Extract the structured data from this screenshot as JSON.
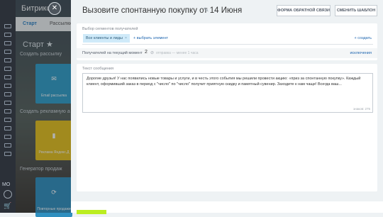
{
  "app": {
    "brand": "Битрикс"
  },
  "background": {
    "tabs": [
      {
        "label": "Старт"
      },
      {
        "label": "Рассылки"
      }
    ],
    "start_heading": "Старт ★",
    "sections": [
      {
        "label": "Создать рассылку"
      },
      {
        "label": "Создать рекламную а"
      },
      {
        "label": "Генератор продаж"
      }
    ],
    "cards": [
      {
        "label": "Email рассылка",
        "color": "#2f9fc9"
      },
      {
        "label": "Реклама Яндекс.Д",
        "color": "#e8c21a"
      },
      {
        "label": "Повторные продажи",
        "color": "#2f8fbf"
      }
    ]
  },
  "left_rail": {
    "badge": "МО"
  },
  "header": {
    "title": "Вызовите спонтанную покупку от 14 Июня",
    "feedback_label": "Форма обратной связи",
    "change_template_label": "Сменить шаблон"
  },
  "segments": {
    "label": "Выбор сегментов получателей",
    "selected_chip": "Все клиенты и лиды",
    "choose_link": "+ выбрать элемент",
    "create_link": "+ создать",
    "recipients_label": "Получателей на текущий момент",
    "recipients_count": "2",
    "recipients_note": "отправка — менее 1 часа",
    "exclusions_link": "исключения"
  },
  "message": {
    "label": "Текст сообщения",
    "text": "Дорогие друзья! У нас появились новые товары и услуги, и в честь этого события мы решили провести акцию: «приз за спонтанную покупку». Каждый клиент, оформивший заказ в период с \"число\" по \"число\" получит приятную скидку и памятный сувенир. Заходите к нам чаще! Всегда ваш...",
    "char_count": "знаков: 275"
  },
  "colors": {
    "accent_green": "#bbed21",
    "link_blue": "#2067b0",
    "chip_bg": "#cfeaf9",
    "sidebar_dark": "#2b3038"
  }
}
